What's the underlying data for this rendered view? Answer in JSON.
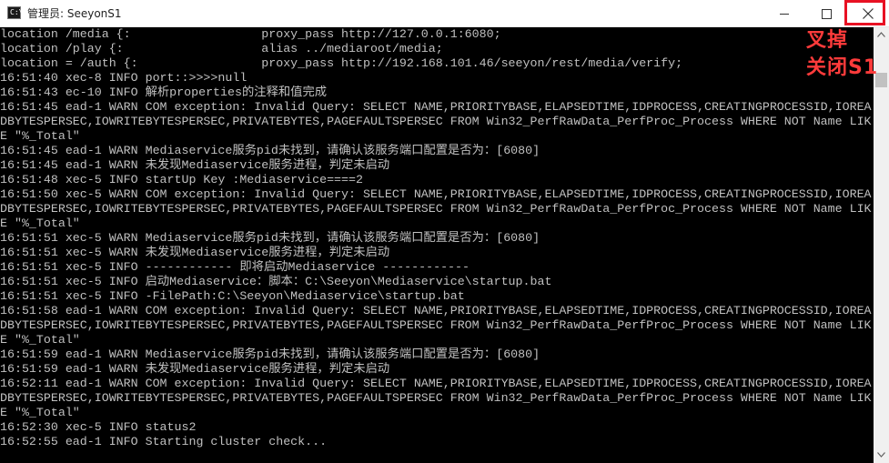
{
  "window": {
    "title": "管理员:  SeeyonS1",
    "icon": "cmd-icon",
    "icon_prompt": "C:\\",
    "controls": [
      "minimize-icon",
      "maximize-icon",
      "close-icon"
    ],
    "close_highlight_color": "#e81123"
  },
  "console": {
    "text_color": "#c0c0c0",
    "background": "#000000",
    "lines": [
      "location /media {:                  proxy_pass http://127.0.0.1:6080;",
      "location /play {:                   alias ../mediaroot/media;",
      "location = /auth {:                 proxy_pass http://192.168.101.46/seeyon/rest/media/verify;",
      "16:51:40 xec-8 INFO port::>>>>null",
      "16:51:43 ec-10 INFO 解析properties的注释和值完成",
      "16:51:45 ead-1 WARN COM exception: Invalid Query: SELECT NAME,PRIORITYBASE,ELAPSEDTIME,IDPROCESS,CREATINGPROCESSID,IOREA",
      "DBYTESPERSEC,IOWRITEBYTESPERSEC,PRIVATEBYTES,PAGEFAULTSPERSEC FROM Win32_PerfRawData_PerfProc_Process WHERE NOT Name LIK",
      "E \"%_Total\"",
      "16:51:45 ead-1 WARN Mediaservice服务pid未找到，请确认该服务端口配置是否为：[6080]",
      "16:51:45 ead-1 WARN 未发现Mediaservice服务进程，判定未启动",
      "16:51:48 xec-5 INFO startUp Key :Mediaservice====2",
      "16:51:50 xec-5 WARN COM exception: Invalid Query: SELECT NAME,PRIORITYBASE,ELAPSEDTIME,IDPROCESS,CREATINGPROCESSID,IOREA",
      "DBYTESPERSEC,IOWRITEBYTESPERSEC,PRIVATEBYTES,PAGEFAULTSPERSEC FROM Win32_PerfRawData_PerfProc_Process WHERE NOT Name LIK",
      "E \"%_Total\"",
      "16:51:51 xec-5 WARN Mediaservice服务pid未找到，请确认该服务端口配置是否为：[6080]",
      "16:51:51 xec-5 WARN 未发现Mediaservice服务进程，判定未启动",
      "16:51:51 xec-5 INFO ------------ 即将启动Mediaservice ------------",
      "16:51:51 xec-5 INFO 启动Mediaservice：脚本：C:\\Seeyon\\Mediaservice\\startup.bat",
      "16:51:51 xec-5 INFO -FilePath:C:\\Seeyon\\Mediaservice\\startup.bat",
      "16:51:58 ead-1 WARN COM exception: Invalid Query: SELECT NAME,PRIORITYBASE,ELAPSEDTIME,IDPROCESS,CREATINGPROCESSID,IOREA",
      "DBYTESPERSEC,IOWRITEBYTESPERSEC,PRIVATEBYTES,PAGEFAULTSPERSEC FROM Win32_PerfRawData_PerfProc_Process WHERE NOT Name LIK",
      "E \"%_Total\"",
      "16:51:59 ead-1 WARN Mediaservice服务pid未找到，请确认该服务端口配置是否为：[6080]",
      "16:51:59 ead-1 WARN 未发现Mediaservice服务进程，判定未启动",
      "16:52:11 ead-1 WARN COM exception: Invalid Query: SELECT NAME,PRIORITYBASE,ELAPSEDTIME,IDPROCESS,CREATINGPROCESSID,IOREA",
      "DBYTESPERSEC,IOWRITEBYTESPERSEC,PRIVATEBYTES,PAGEFAULTSPERSEC FROM Win32_PerfRawData_PerfProc_Process WHERE NOT Name LIK",
      "E \"%_Total\"",
      "16:52:30 xec-5 INFO status2",
      "16:52:55 ead-1 INFO Starting cluster check..."
    ]
  },
  "annotation": {
    "lines": [
      "叉掉",
      "关闭S1"
    ],
    "color": "#ff3b3b"
  },
  "scrollbar": {
    "icons": [
      "scroll-up-arrow-icon",
      "scroll-down-arrow-icon"
    ]
  }
}
